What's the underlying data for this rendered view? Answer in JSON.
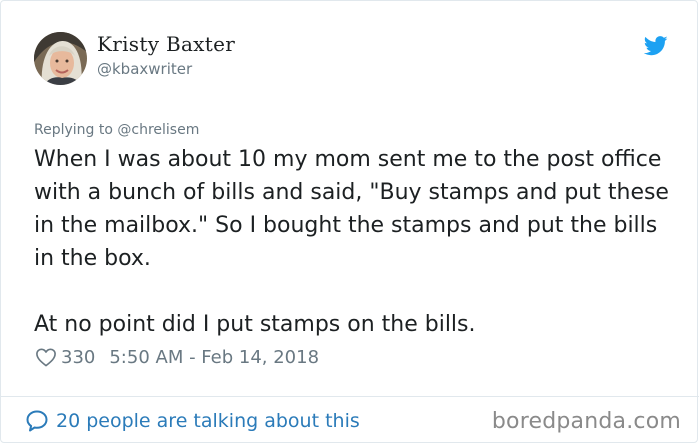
{
  "author": {
    "display_name": "Kristy Baxter",
    "handle": "@kbaxwriter",
    "avatar_icon": "avatar-photo"
  },
  "brand_icon": "twitter-bird-icon",
  "tweet": {
    "reply_context": "Replying to @chrelisem",
    "paragraphs": [
      "When I was about 10 my mom sent me to the post office with a bunch of bills and said, \"Buy stamps and put these in the mailbox.\" So I bought the stamps and put the bills in the box.",
      "At no point did I put stamps on the bills."
    ],
    "like_count": "330",
    "timestamp": "5:50 AM - Feb 14, 2018"
  },
  "footer": {
    "conversation_link": "20 people are talking about this",
    "watermark": "boredpanda.com"
  },
  "colors": {
    "text": "#1c2022",
    "secondary_text": "#697882",
    "link": "#2b7bb9",
    "twitter_blue": "#1da1f2",
    "border": "#e1e8ed",
    "watermark": "#8a8a8a"
  }
}
